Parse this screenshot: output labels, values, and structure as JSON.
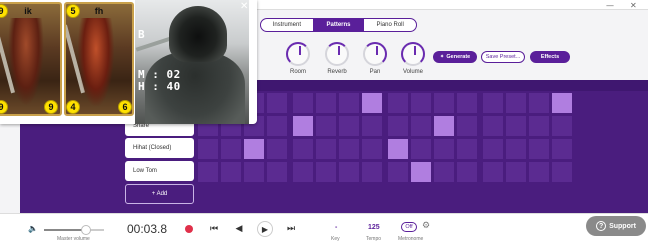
{
  "window": {
    "minimize": "—",
    "close": "✕"
  },
  "tabs": [
    {
      "label": "Instrument",
      "active": false
    },
    {
      "label": "Patterns",
      "active": true
    },
    {
      "label": "Piano Roll",
      "active": false
    }
  ],
  "knobs": [
    {
      "label": "Room"
    },
    {
      "label": "Reverb"
    },
    {
      "label": "Pan"
    },
    {
      "label": "Volume"
    }
  ],
  "buttons": {
    "generate": "Generate",
    "save_preset": "Save Preset...",
    "effects": "Effects",
    "add": "+ Add"
  },
  "instruments": [
    "Snare",
    "Hihat (Closed)",
    "Low Tom"
  ],
  "grid": {
    "steps": 16,
    "active": [
      {
        "row": 0,
        "step": 7
      },
      {
        "row": 0,
        "step": 15
      },
      {
        "row": 1,
        "step": 4
      },
      {
        "row": 1,
        "step": 10
      },
      {
        "row": 2,
        "step": 2
      },
      {
        "row": 2,
        "step": 8
      },
      {
        "row": 3,
        "step": 9
      }
    ]
  },
  "transport": {
    "time": "00:03.8",
    "master_volume_label": "Master volume",
    "master_volume": 0.7,
    "key_value": "-",
    "key_label": "Key",
    "tempo_value": "125",
    "tempo_label": "Tempo",
    "metronome_value": "Off",
    "metronome_label": "Metronome"
  },
  "support": {
    "label": "Support",
    "icon": "?"
  },
  "game_overlay": {
    "cards": [
      {
        "name": "ik",
        "top_left": "9",
        "bottom_left": "9",
        "bottom_right": "9"
      },
      {
        "name": "fh",
        "top_left": "5",
        "bottom_left": "4",
        "bottom_right": "6"
      }
    ],
    "stats": {
      "b": "B",
      "m": "M : 02",
      "h": "H : 40"
    }
  }
}
